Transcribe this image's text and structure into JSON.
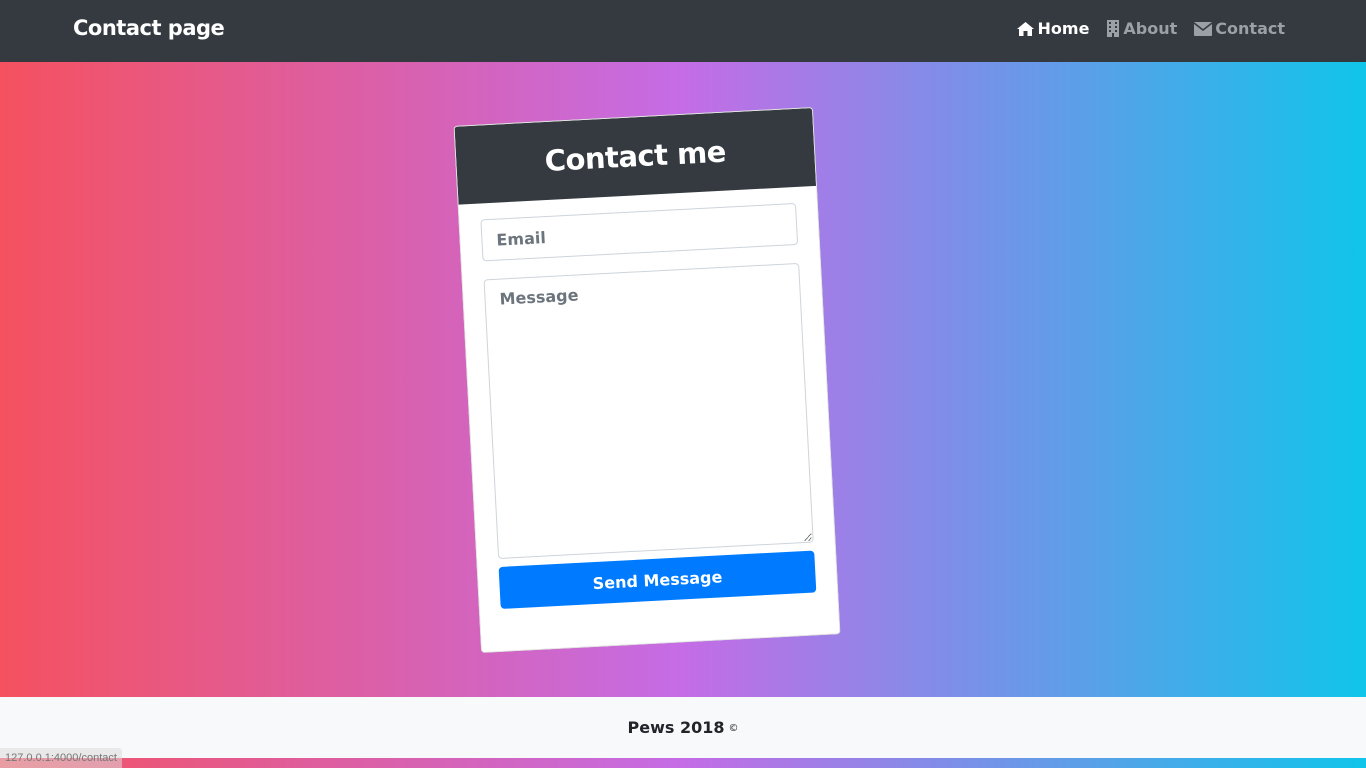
{
  "navbar": {
    "brand": "Contact page",
    "links": [
      {
        "label": "Home",
        "icon": "home-icon",
        "active": true
      },
      {
        "label": "About",
        "icon": "building-icon",
        "active": false
      },
      {
        "label": "Contact",
        "icon": "envelope-icon",
        "active": false
      }
    ]
  },
  "contact_form": {
    "title": "Contact me",
    "email_placeholder": "Email",
    "message_placeholder": "Message",
    "submit_label": "Send Message"
  },
  "footer": {
    "text": "Pews 2018",
    "copyright_symbol": "©"
  },
  "status_url": "127.0.0.1:4000/contact",
  "colors": {
    "navbar_bg": "#343a40",
    "gradient_start": "#f5515f",
    "gradient_mid": "#c56ce6",
    "gradient_end": "#10c4ea",
    "primary_button": "#007bff",
    "footer_bg": "#f8f9fa"
  }
}
